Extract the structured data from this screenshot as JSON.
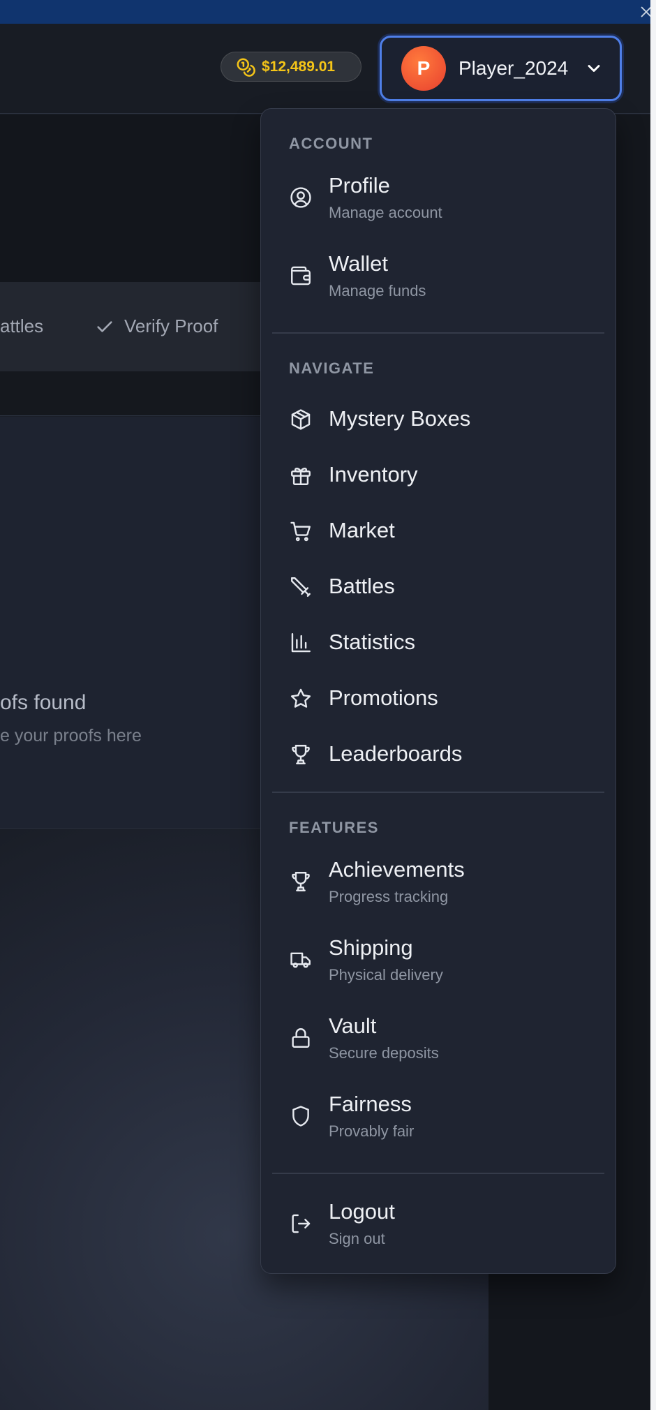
{
  "header": {
    "balance": "$12,489.01",
    "user": {
      "initial": "P",
      "name": "Player_2024"
    }
  },
  "background": {
    "tab_battles": "attles",
    "tab_verify": "Verify Proof",
    "empty_title": "ofs found",
    "empty_subtitle": "e your proofs here"
  },
  "menu": {
    "account": {
      "label": "ACCOUNT",
      "items": [
        {
          "label": "Profile",
          "desc": "Manage account",
          "icon": "user-circle-icon"
        },
        {
          "label": "Wallet",
          "desc": "Manage funds",
          "icon": "wallet-icon"
        }
      ]
    },
    "navigate": {
      "label": "NAVIGATE",
      "items": [
        {
          "label": "Mystery Boxes",
          "icon": "box-icon"
        },
        {
          "label": "Inventory",
          "icon": "gift-icon"
        },
        {
          "label": "Market",
          "icon": "cart-icon"
        },
        {
          "label": "Battles",
          "icon": "sword-icon"
        },
        {
          "label": "Statistics",
          "icon": "bar-chart-icon"
        },
        {
          "label": "Promotions",
          "icon": "star-icon"
        },
        {
          "label": "Leaderboards",
          "icon": "trophy-icon"
        }
      ]
    },
    "features": {
      "label": "FEATURES",
      "items": [
        {
          "label": "Achievements",
          "desc": "Progress tracking",
          "icon": "trophy-icon"
        },
        {
          "label": "Shipping",
          "desc": "Physical delivery",
          "icon": "truck-icon"
        },
        {
          "label": "Vault",
          "desc": "Secure deposits",
          "icon": "lock-icon"
        },
        {
          "label": "Fairness",
          "desc": "Provably fair",
          "icon": "shield-icon"
        }
      ]
    },
    "logout": {
      "label": "Logout",
      "desc": "Sign out",
      "icon": "logout-icon"
    }
  },
  "colors": {
    "banner": "#10346e",
    "balance_text": "#f5c518",
    "user_button_focus": "#4f7fe8",
    "avatar": "#e8402f",
    "menu_bg": "#1f2431"
  }
}
